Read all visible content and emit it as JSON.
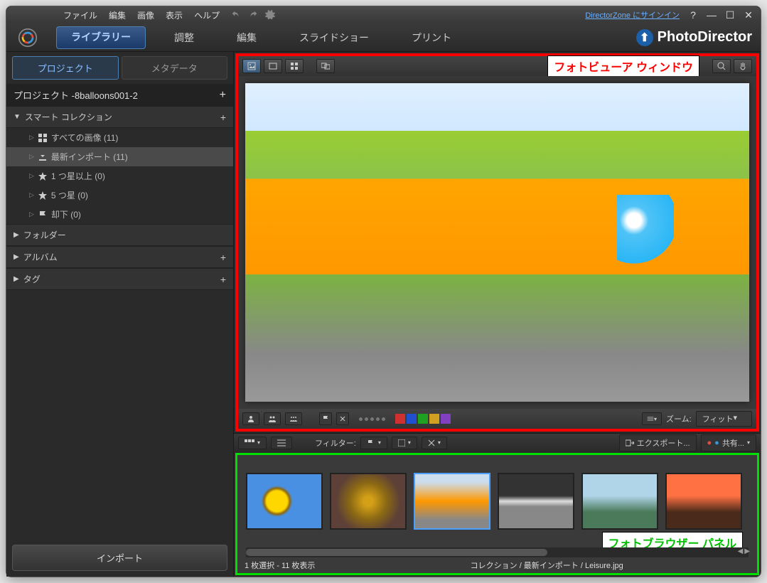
{
  "menu": {
    "file": "ファイル",
    "edit": "編集",
    "image": "画像",
    "view": "表示",
    "help": "ヘルプ",
    "signin": "DirectorZone にサインイン"
  },
  "tabs": {
    "library": "ライブラリー",
    "adjust": "調整",
    "edit": "編集",
    "slideshow": "スライドショー",
    "print": "プリント"
  },
  "brand": "PhotoDirector",
  "sidebar": {
    "tab_project": "プロジェクト",
    "tab_metadata": "メタデータ",
    "project_name": "プロジェクト -8balloons001-2",
    "smart_collection": "スマート コレクション",
    "items": [
      {
        "label": "すべての画像 (11)"
      },
      {
        "label": "最新インポート (11)"
      },
      {
        "label": "1 つ星以上 (0)"
      },
      {
        "label": "5 つ星 (0)"
      },
      {
        "label": "却下 (0)"
      }
    ],
    "folder": "フォルダー",
    "album": "アルバム",
    "tag": "タグ",
    "import": "インポート"
  },
  "viewer": {
    "annotation": "フォトビューア ウィンドウ",
    "zoom_label": "ズーム:",
    "zoom_value": "フィット",
    "colors": [
      "#d03030",
      "#2050d0",
      "#20a020",
      "#d0a020",
      "#8040c0"
    ]
  },
  "browser": {
    "filter_label": "フィルター:",
    "export": "エクスポート...",
    "share": "共有...",
    "annotation": "フォトブラウザー パネル",
    "status_selection": "1 枚選択 - 11 枚表示",
    "status_path": "コレクション / 最新インポート / Leisure.jpg"
  }
}
